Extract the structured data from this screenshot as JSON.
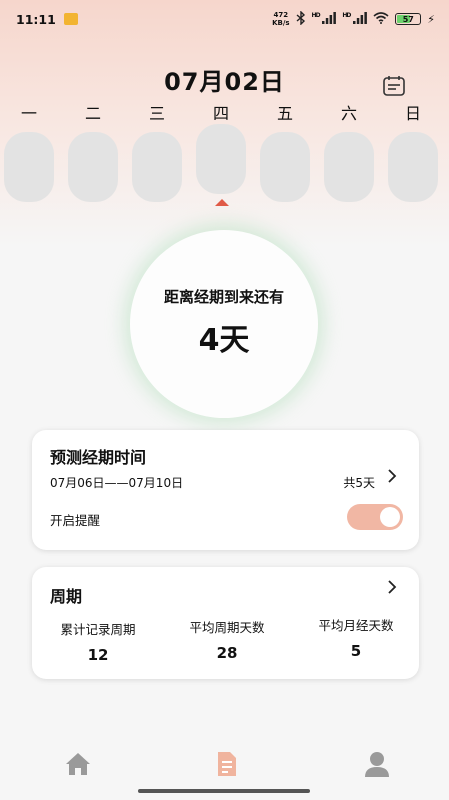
{
  "status_bar": {
    "time": "11:11",
    "net_speed_value": "472",
    "net_speed_unit": "KB/s",
    "signal_1": "HD",
    "signal_2": "HD",
    "battery": "57"
  },
  "header": {
    "date": "07月02日"
  },
  "week": {
    "days": [
      "一",
      "二",
      "三",
      "四",
      "五",
      "六",
      "日"
    ],
    "selected_index": 3
  },
  "countdown": {
    "label": "距离经期到来还有",
    "value": "4天"
  },
  "prediction": {
    "title": "预测经期时间",
    "range": "07月06日——07月10日",
    "total": "共5天",
    "remind_label": "开启提醒",
    "remind_on": true
  },
  "cycle": {
    "title": "周期",
    "stats": [
      {
        "label": "累计记录周期",
        "value": "12"
      },
      {
        "label": "平均周期天数",
        "value": "28"
      },
      {
        "label": "平均月经天数",
        "value": "5"
      }
    ]
  },
  "nav": {
    "items": [
      "home-icon",
      "record-icon",
      "profile-icon"
    ],
    "active_color": "#f0b49e",
    "inactive_color": "#9a9a9a"
  }
}
